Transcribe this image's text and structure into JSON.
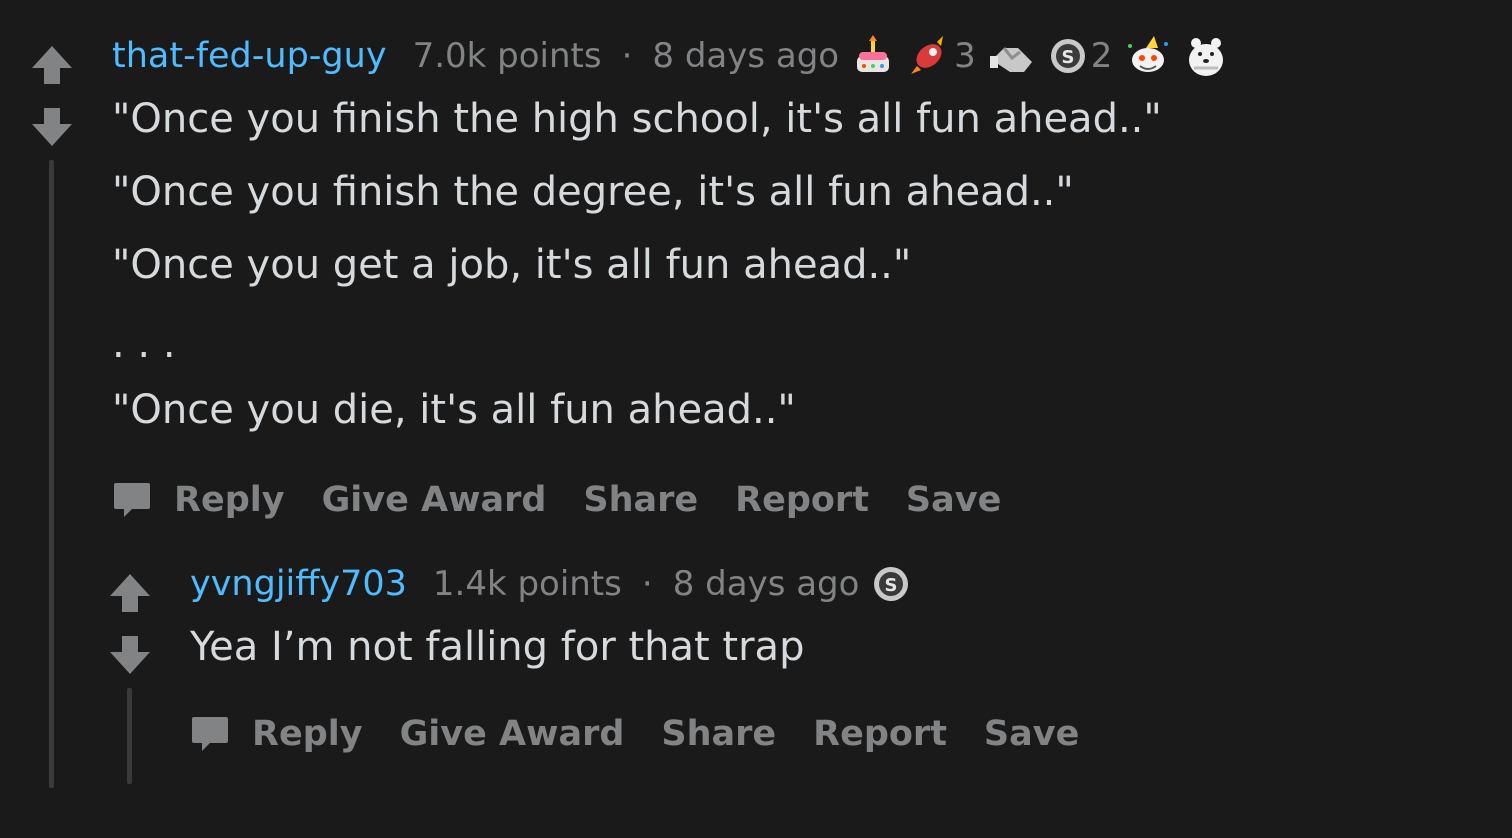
{
  "comments": [
    {
      "username": "that-fed-up-guy",
      "points": "7.0k points",
      "separator": "·",
      "age": "8 days ago",
      "awards": [
        {
          "icon": "cake-award-icon",
          "count": ""
        },
        {
          "icon": "rocket-like-award-icon",
          "count": "3"
        },
        {
          "icon": "hand-shake-award-icon",
          "count": ""
        },
        {
          "icon": "silver-award-icon",
          "count": "2"
        },
        {
          "icon": "snoo-party-award-icon",
          "count": ""
        },
        {
          "icon": "polar-bear-award-icon",
          "count": ""
        }
      ],
      "lines": [
        "\"Once you finish the high school, it's all fun ahead..\"",
        "\"Once you finish the degree, it's all fun ahead..\"",
        "\"Once you get a job, it's all fun ahead..\"",
        ". . .",
        "\"Once you die, it's all fun ahead..\""
      ],
      "actions": {
        "reply": "Reply",
        "give_award": "Give Award",
        "share": "Share",
        "report": "Report",
        "save": "Save"
      }
    },
    {
      "username": "yvngjiffy703",
      "points": "1.4k points",
      "separator": "·",
      "age": "8 days ago",
      "awards": [
        {
          "icon": "silver-award-icon",
          "count": ""
        }
      ],
      "lines": [
        "Yea I’m not falling for that trap"
      ],
      "actions": {
        "reply": "Reply",
        "give_award": "Give Award",
        "share": "Share",
        "report": "Report",
        "save": "Save"
      }
    }
  ],
  "colors": {
    "background": "#1a1a1b",
    "username": "#4fbcff",
    "meta_text": "#818384",
    "body_text": "#d7dadc",
    "vote_arrow": "#818384",
    "thread_line": "#3a3a3c"
  }
}
